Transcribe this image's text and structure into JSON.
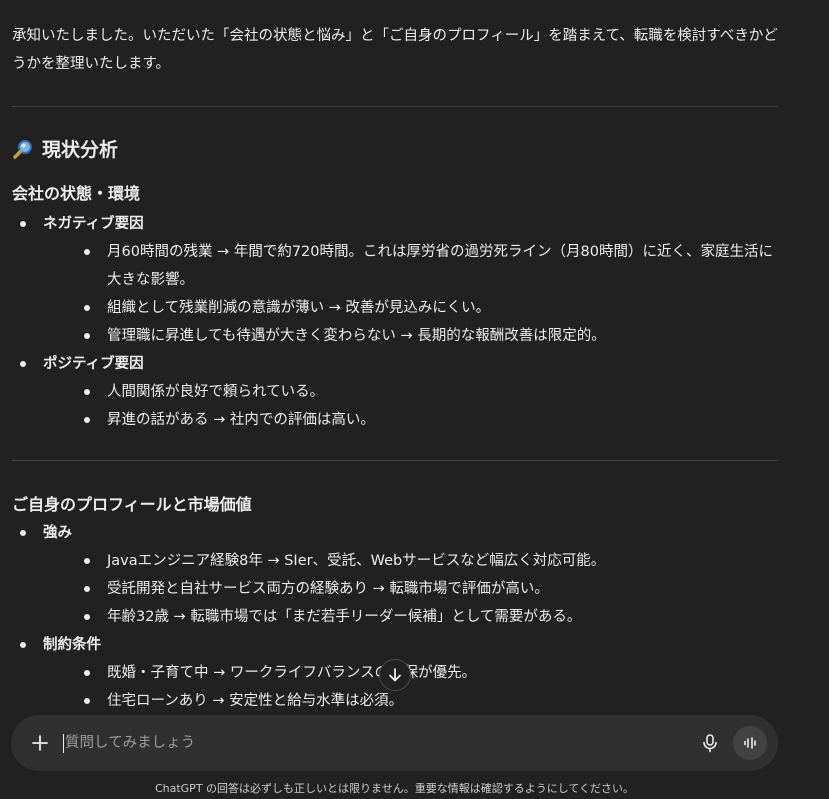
{
  "intro": "承知いたしました。いただいた「会社の状態と悩み」と「ご自身のプロフィール」を踏まえて、転職を検討すべきかどうかを整理いたします。",
  "section1": {
    "title": "現状分析",
    "icon": "magnifier-icon",
    "sub": "会社の状態・環境",
    "groups": [
      {
        "label": "ネガティブ要因",
        "items": [
          "月60時間の残業 → 年間で約720時間。これは厚労省の過労死ライン（月80時間）に近く、家庭生活に大きな影響。",
          "組織として残業削減の意識が薄い → 改善が見込みにくい。",
          "管理職に昇進しても待遇が大きく変わらない → 長期的な報酬改善は限定的。"
        ]
      },
      {
        "label": "ポジティブ要因",
        "items": [
          "人間関係が良好で頼られている。",
          "昇進の話がある → 社内での評価は高い。"
        ]
      }
    ]
  },
  "section2": {
    "sub": "ご自身のプロフィールと市場価値",
    "groups": [
      {
        "label": "強み",
        "items": [
          "Javaエンジニア経験8年 → SIer、受託、Webサービスなど幅広く対応可能。",
          "受託開発と自社サービス両方の経験あり → 転職市場で評価が高い。",
          "年齢32歳 → 転職市場では「まだ若手リーダー候補」として需要がある。"
        ]
      },
      {
        "label": "制約条件",
        "items": [
          "既婚・子育て中 → ワークライフバランスの確保が優先。",
          "住宅ローンあり → 安定性と給与水準は必須。"
        ]
      }
    ]
  },
  "composer": {
    "placeholder": "質問してみましょう"
  },
  "disclaimer": "ChatGPT の回答は必ずしも正しいとは限りません。重要な情報は確認するようにしてください。"
}
